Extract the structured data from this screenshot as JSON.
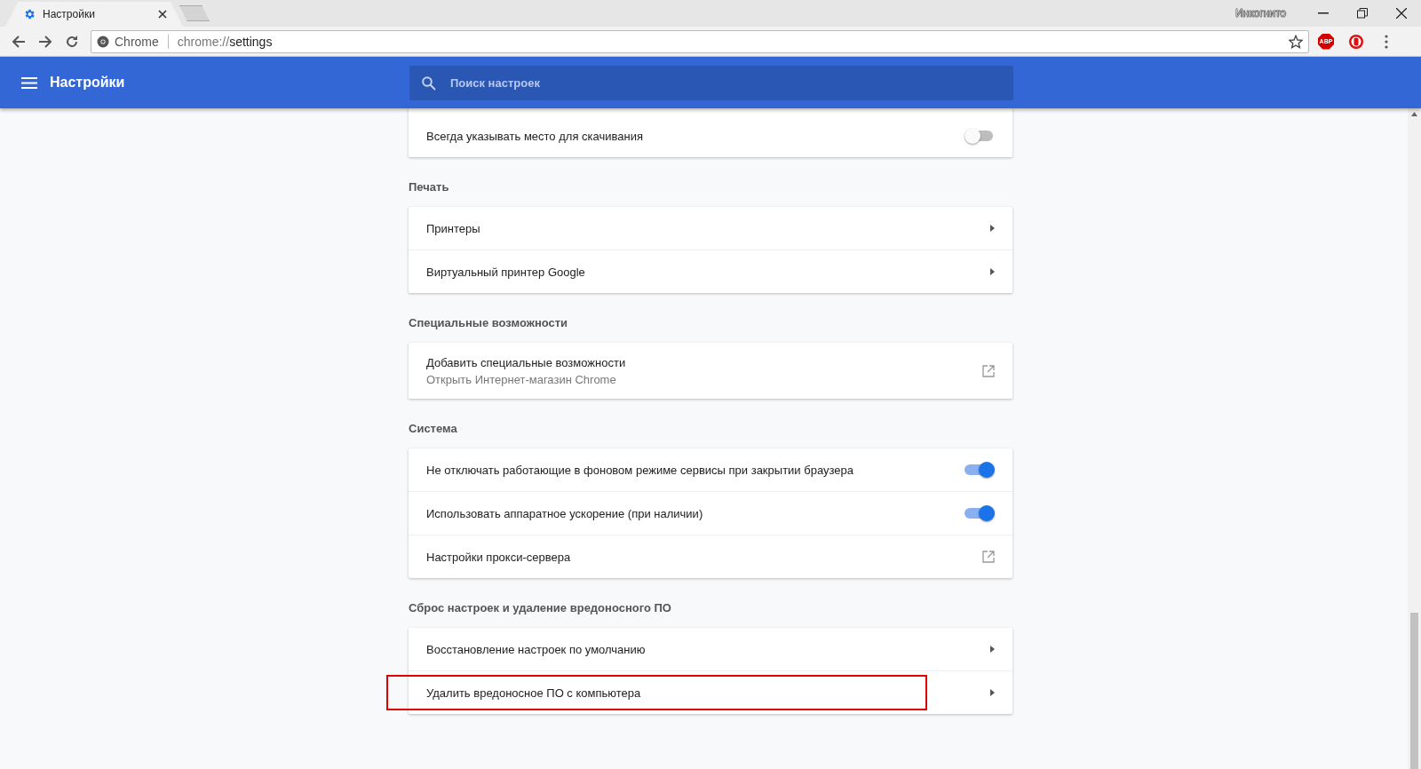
{
  "browser": {
    "tab": {
      "title": "Настройки",
      "selected": true
    },
    "profile_label": "Инкогнито",
    "site_label": "Chrome",
    "url": {
      "scheme": "chrome://",
      "path": "settings"
    },
    "extension_badge": "ABP"
  },
  "header": {
    "title": "Настройки",
    "search": {
      "placeholder": "Поиск настроек"
    }
  },
  "sections": [
    {
      "rows": [
        {
          "kind": "toggle",
          "label": "Всегда указывать место для скачивания",
          "on": false,
          "highlighted": false
        }
      ]
    },
    {
      "title": "Печать",
      "rows": [
        {
          "kind": "arrow",
          "label": "Принтеры",
          "highlighted": false
        },
        {
          "kind": "arrow",
          "label": "Виртуальный принтер Google",
          "highlighted": false
        }
      ]
    },
    {
      "title": "Специальные возможности",
      "rows": [
        {
          "kind": "external",
          "label": "Добавить специальные возможности",
          "sublabel": "Открыть Интернет-магазин Chrome",
          "highlighted": false
        }
      ]
    },
    {
      "title": "Система",
      "rows": [
        {
          "kind": "toggle",
          "label": "Не отключать работающие в фоновом режиме сервисы при закрытии браузера",
          "on": true,
          "highlighted": false
        },
        {
          "kind": "toggle",
          "label": "Использовать аппаратное ускорение (при наличии)",
          "on": true,
          "highlighted": false
        },
        {
          "kind": "external",
          "label": "Настройки прокси-сервера",
          "highlighted": false
        }
      ]
    },
    {
      "title": "Сброс настроек и удаление вредоносного ПО",
      "rows": [
        {
          "kind": "arrow",
          "label": "Восстановление настроек по умолчанию",
          "highlighted": false
        },
        {
          "kind": "arrow",
          "label": "Удалить вредоносное ПО с компьютера",
          "highlighted": true
        }
      ]
    }
  ]
}
